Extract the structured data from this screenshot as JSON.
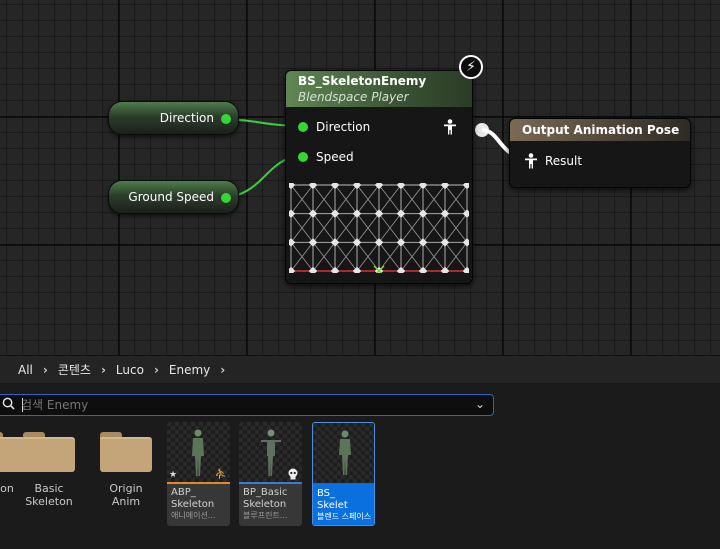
{
  "graph": {
    "var_nodes": [
      {
        "label": "Direction"
      },
      {
        "label": "Ground Speed"
      }
    ],
    "blendspace_node": {
      "title": "BS_SkeletonEnemy",
      "subtitle": "Blendspace Player",
      "pins": [
        {
          "label": "Direction"
        },
        {
          "label": "Speed"
        }
      ],
      "output_icon": "person-pose-icon",
      "event_icon": "lightning-bolt-icon"
    },
    "output_node": {
      "title": "Output Animation Pose",
      "result_label": "Result",
      "result_icon": "person-pose-icon"
    },
    "colors": {
      "float_pin": "#35d535",
      "bs_header": "#5f8753",
      "output_header": "#7a6a55",
      "sample_line": "#d83030"
    }
  },
  "content_browser": {
    "breadcrumbs": [
      "All",
      "콘텐츠",
      "Luco",
      "Enemy"
    ],
    "search": {
      "value": "",
      "placeholder": "검색 Enemy"
    },
    "folders": [
      {
        "label": "on"
      },
      {
        "label": "Basic\nSkeleton"
      },
      {
        "label": "Origin\nAnim"
      }
    ],
    "assets": [
      {
        "name": "ABP_\nSkeleton",
        "type": "애니메이션...",
        "bar_color": "#e08a2a",
        "selected": false
      },
      {
        "name": "BP_Basic\nSkeleton",
        "type": "블루프린트...",
        "bar_color": "#3a7ad8",
        "selected": false
      },
      {
        "name": "BS_\nSkelet",
        "type": "블렌드 스페이스",
        "bar_color": "#0a70e0",
        "selected": true
      }
    ],
    "accent_color": "#2d63c4"
  }
}
